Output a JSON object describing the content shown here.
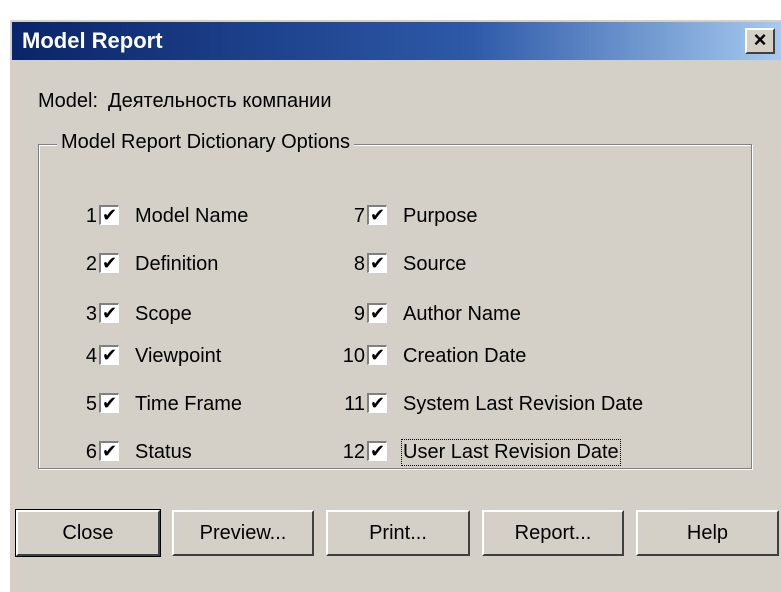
{
  "window": {
    "title": "Model Report",
    "close_glyph": "×"
  },
  "model": {
    "label": "Model:",
    "value": "Деятельность компании"
  },
  "group": {
    "title": "Model Report Dictionary Options"
  },
  "options_left": [
    {
      "num": "1",
      "label": "Model Name",
      "checked": true
    },
    {
      "num": "2",
      "label": "Definition",
      "checked": true
    },
    {
      "num": "3",
      "label": "Scope",
      "checked": true
    },
    {
      "num": "4",
      "label": "Viewpoint",
      "checked": true
    },
    {
      "num": "5",
      "label": "Time Frame",
      "checked": true
    },
    {
      "num": "6",
      "label": "Status",
      "checked": true
    }
  ],
  "options_right": [
    {
      "num": "7",
      "label": "Purpose",
      "checked": true
    },
    {
      "num": "8",
      "label": "Source",
      "checked": true
    },
    {
      "num": "9",
      "label": "Author Name",
      "checked": true
    },
    {
      "num": "10",
      "label": "Creation Date",
      "checked": true
    },
    {
      "num": "11",
      "label": "System Last Revision Date",
      "checked": true
    },
    {
      "num": "12",
      "label": "User Last Revision Date",
      "checked": true
    }
  ],
  "check_glyph": "✔",
  "buttons": {
    "close": "Close",
    "preview": "Preview...",
    "print": "Print...",
    "report": "Report...",
    "help": "Help"
  }
}
